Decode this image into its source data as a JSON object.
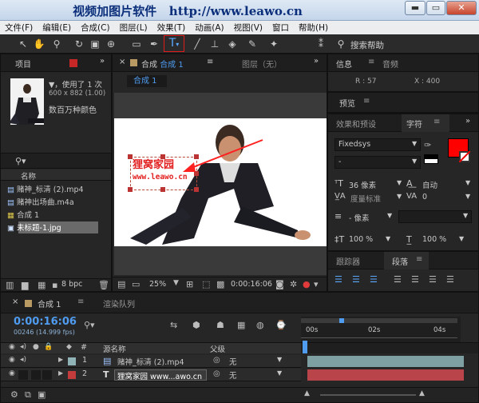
{
  "window": {
    "title_cn": "视频加图片软件",
    "title_url": "http://www.leawo.cn",
    "minimize": "▬",
    "maximize": "▭",
    "close": "✕"
  },
  "menu": [
    "文件(F)",
    "编辑(E)",
    "合成(C)",
    "图层(L)",
    "效果(T)",
    "动画(A)",
    "视图(V)",
    "窗口",
    "帮助(H)"
  ],
  "toolbar": {
    "search_label": "搜索帮助"
  },
  "project": {
    "tab_label": "项目",
    "usage": "▼，使用了 1 次",
    "dims": "600 x 882 (1.00)",
    "colors": "数百万种颜色",
    "column_name": "名称",
    "items": [
      {
        "name": "赌神_标清 (2).mp4",
        "icon": "film-icon"
      },
      {
        "name": "赌神出场曲.m4a",
        "icon": "audio-icon"
      },
      {
        "name": "合成 1",
        "icon": "composition-icon"
      },
      {
        "name": "未标题-1.jpg",
        "icon": "image-icon"
      }
    ],
    "bpc": "8 bpc"
  },
  "comp": {
    "tab_label": "合成",
    "tab_name": "合成 1",
    "layer_tab": "图层（无）",
    "subtab": "合成 1",
    "overlay_line1": "狸窝家园",
    "overlay_line2": "www.leawo.cn",
    "zoom": "25%",
    "timecode": "0:00:16:06"
  },
  "info": {
    "tab_label": "信息",
    "audio_tab": "音频",
    "r": "R : 57",
    "x": "X : 400"
  },
  "preview": {
    "tab_label": "预览"
  },
  "effects": {
    "tab_label": "效果和预设"
  },
  "character": {
    "tab_label": "字符",
    "font": "Fixedsys",
    "style": "-",
    "size": "36 像素",
    "leading": "自动",
    "kerning": "度量标准",
    "tracking": "0",
    "stroke": "- 像素",
    "vscale": "100 %",
    "hscale": "100 %",
    "fill_color": "#ff0000"
  },
  "tracker": {
    "tab_label": "跟踪器"
  },
  "paragraph": {
    "tab_label": "段落"
  },
  "timeline": {
    "tab_label": "合成 1",
    "render_tab": "渲染队列",
    "timecode": "0:00:16:06",
    "frames": "00246 (14.999 fps)",
    "ruler": [
      "00s",
      "02s",
      "04s"
    ],
    "header_num": "#",
    "header_source": "源名称",
    "header_parent": "父级",
    "layers": [
      {
        "num": "1",
        "name": "赌神_标清 (2).mp4",
        "parent": "无",
        "label_color": "#8fb3b6"
      },
      {
        "num": "2",
        "name": "狸窝家园 www...awo.cn",
        "parent": "无",
        "label_color": "#c43b3b"
      }
    ]
  }
}
